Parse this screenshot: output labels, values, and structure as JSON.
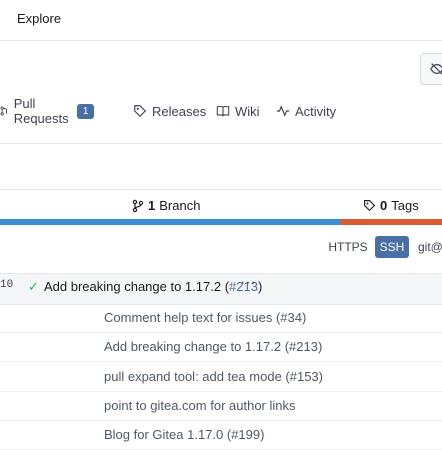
{
  "nav": {
    "explore": "Explore"
  },
  "tabs": [
    {
      "label": "Pull Requests",
      "icon": "pull-request-icon",
      "badge": "1"
    },
    {
      "label": "Releases",
      "icon": "tag-icon"
    },
    {
      "label": "Wiki",
      "icon": "book-icon"
    },
    {
      "label": "Activity",
      "icon": "pulse-icon"
    }
  ],
  "stats": {
    "branches_count": "1",
    "branches_label": "Branch",
    "tags_count": "0",
    "tags_label": "Tags"
  },
  "language_bar_colors": [
    "#3b8fd5",
    "#d95c32"
  ],
  "clone": {
    "https_label": "HTTPS",
    "ssh_label": "SSH",
    "url_prefix": "git@"
  },
  "latest_commit": {
    "sha_fragment": "10",
    "message": "Add breaking change to 1.17.2 (",
    "link": "#213",
    "suffix": ")",
    "more": "···"
  },
  "files": [
    {
      "commit": "Comment help text for issues (#34)"
    },
    {
      "commit": "Add breaking change to 1.17.2 (#213)"
    },
    {
      "commit": "pull expand tool: add tea mode (#153)"
    },
    {
      "commit": "point to gitea.com for author links"
    },
    {
      "commit": "Blog for Gitea 1.17.0 (#199)"
    }
  ],
  "colors": {
    "accent": "#4a6fa5",
    "success": "#21ba45"
  }
}
